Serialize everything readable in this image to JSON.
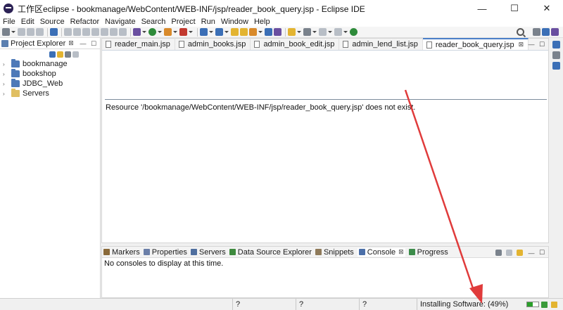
{
  "window": {
    "title": "工作区eclipse - bookmanage/WebContent/WEB-INF/jsp/reader_book_query.jsp - Eclipse IDE",
    "minimize_glyph": "—",
    "maximize_glyph": "☐",
    "close_glyph": "✕"
  },
  "menu": {
    "items": [
      "File",
      "Edit",
      "Source",
      "Refactor",
      "Navigate",
      "Search",
      "Project",
      "Run",
      "Window",
      "Help"
    ]
  },
  "project_explorer": {
    "title": "Project Explorer",
    "close_glyph": "⊠",
    "projects": [
      {
        "name": "bookmanage",
        "icon": "project-icon"
      },
      {
        "name": "bookshop",
        "icon": "project-icon"
      },
      {
        "name": "JDBC_Web",
        "icon": "project-icon"
      },
      {
        "name": "Servers",
        "icon": "folder-icon"
      }
    ]
  },
  "editor": {
    "tabs": [
      {
        "label": "reader_main.jsp",
        "active": false
      },
      {
        "label": "admin_books.jsp",
        "active": false
      },
      {
        "label": "admin_book_edit.jsp",
        "active": false
      },
      {
        "label": "admin_lend_list.jsp",
        "active": false
      },
      {
        "label": "reader_book_query.jsp",
        "active": true
      }
    ],
    "close_glyph": "⊠",
    "message": "Resource '/bookmanage/WebContent/WEB-INF/jsp/reader_book_query.jsp' does not exist."
  },
  "bottom_panel": {
    "tabs": [
      {
        "label": "Markers",
        "color": "#8a6a3a",
        "active": false
      },
      {
        "label": "Properties",
        "color": "#6b7fa8",
        "active": false
      },
      {
        "label": "Servers",
        "color": "#4f6f9f",
        "active": false
      },
      {
        "label": "Data Source Explorer",
        "color": "#3e8a3e",
        "active": false
      },
      {
        "label": "Snippets",
        "color": "#8f7a5a",
        "active": false
      },
      {
        "label": "Console",
        "color": "#4b6fa8",
        "active": true
      },
      {
        "label": "Progress",
        "color": "#3c8c4a",
        "active": false
      }
    ],
    "close_glyph": "⊠",
    "console_message": "No consoles to display at this time."
  },
  "status_bar": {
    "fields": [
      "?",
      "?",
      "?"
    ],
    "installing": "Installing Software: (49%)",
    "progress_fraction": 0.49
  },
  "colors": {
    "accent": "#4b7fc8",
    "annotation_arrow": "#e03b3b"
  }
}
